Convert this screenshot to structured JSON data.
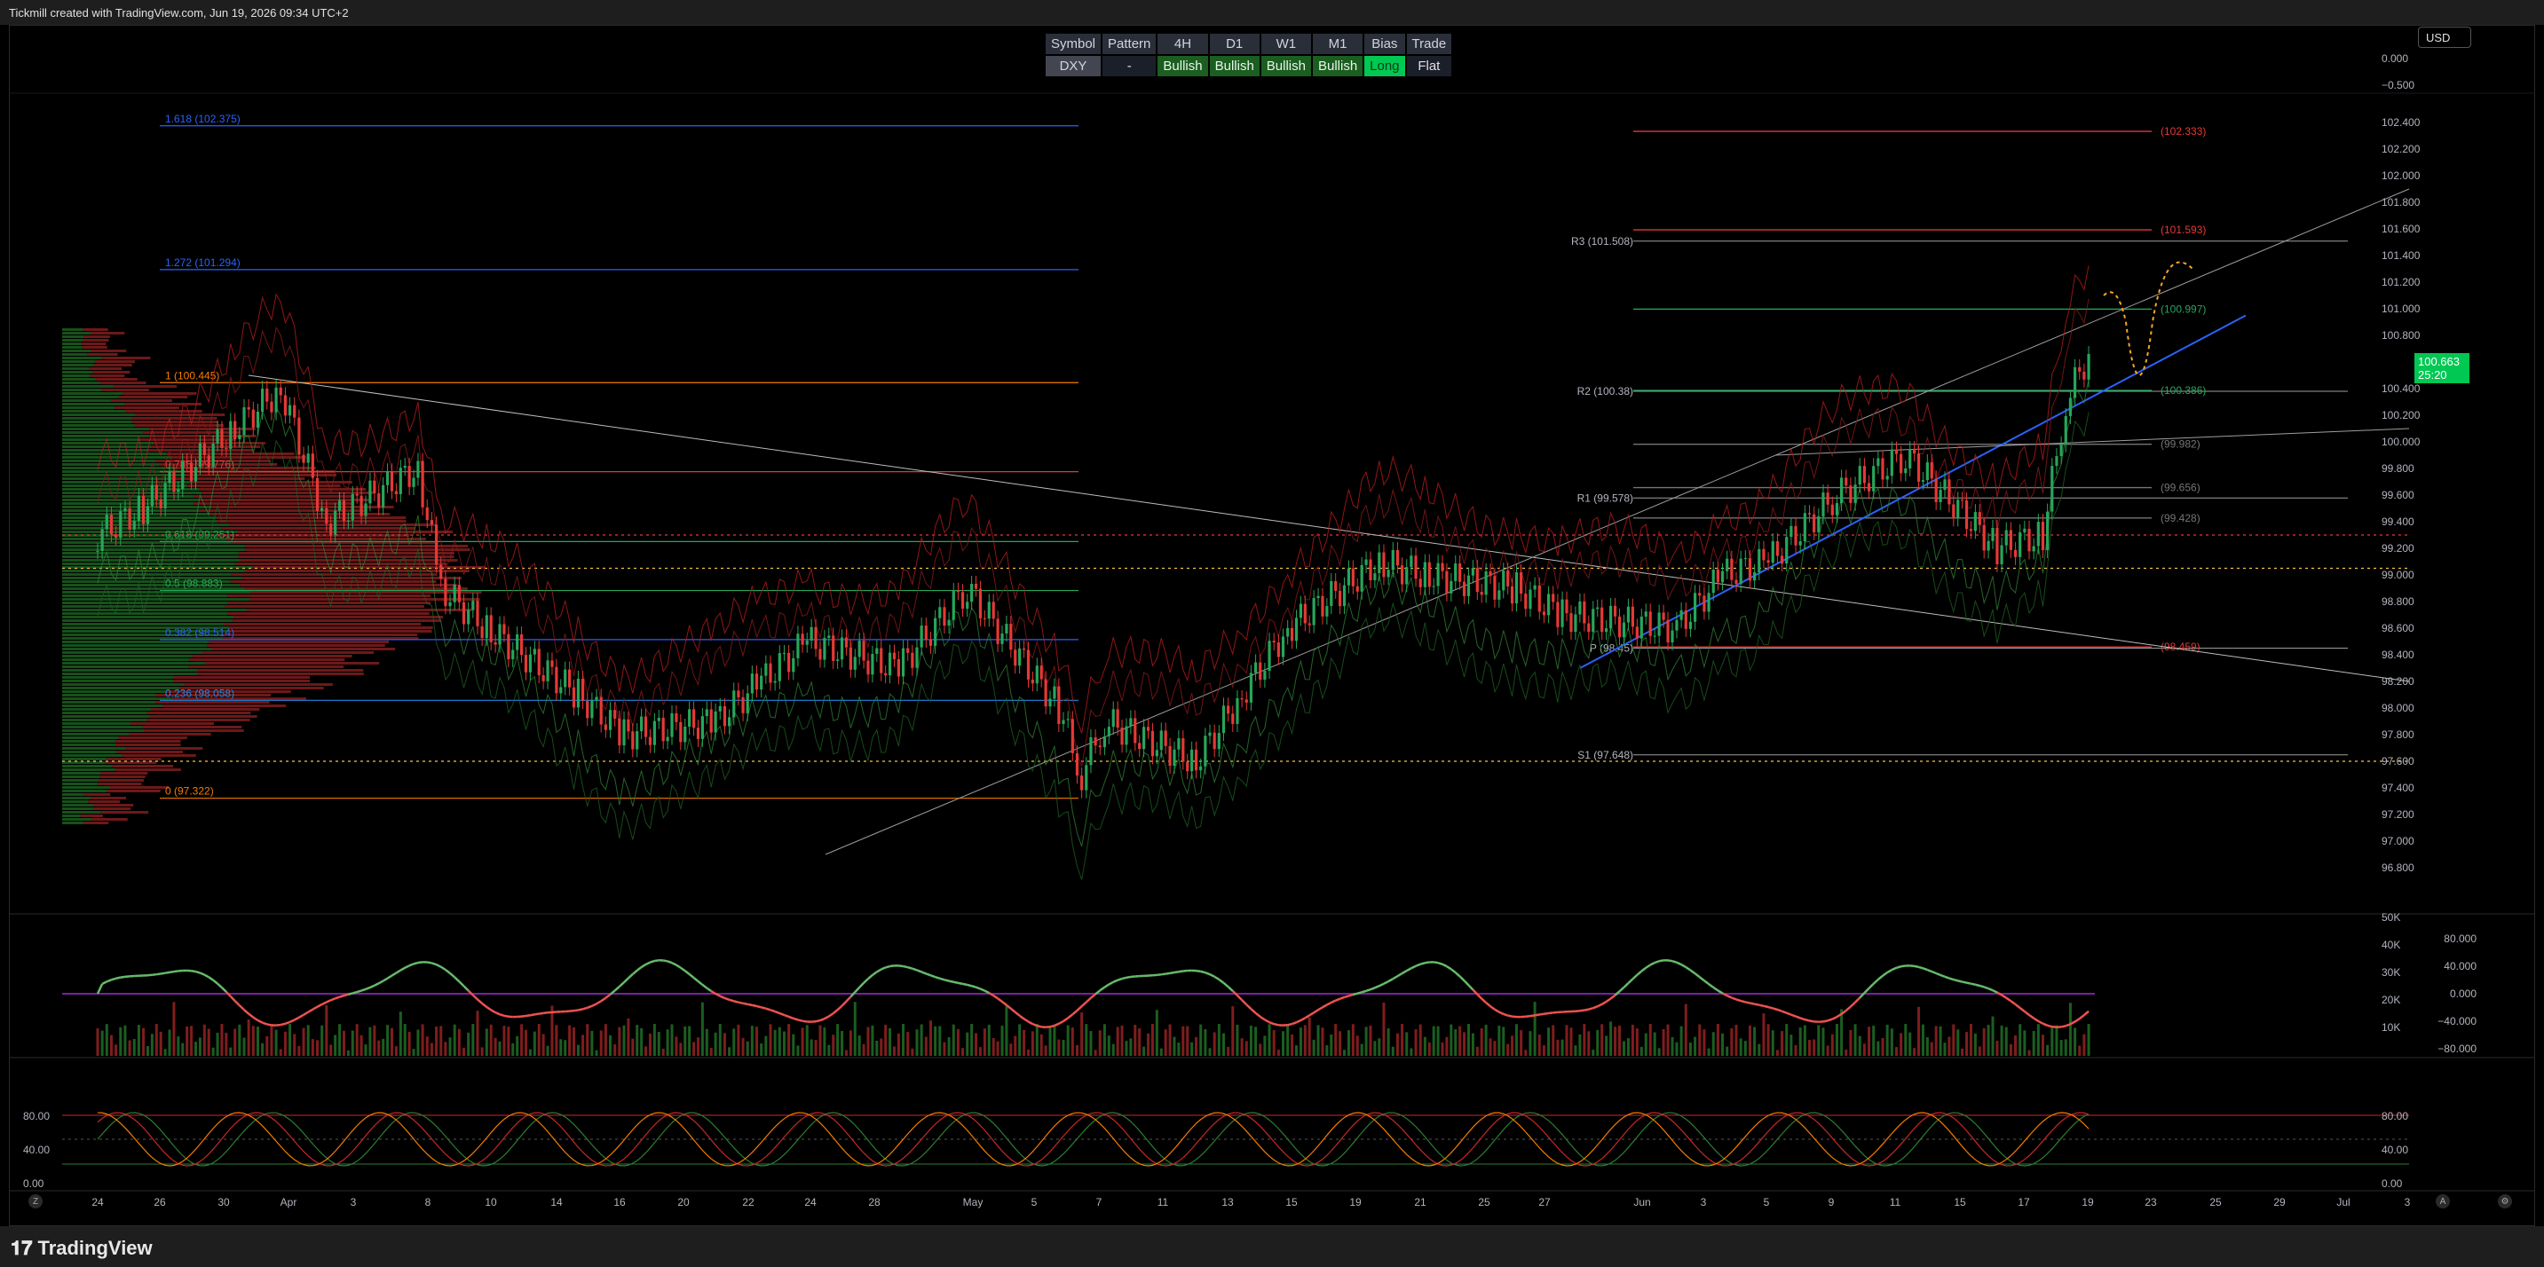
{
  "header": {
    "credit": "Tickmill created with TradingView.com, Jun 19, 2026 09:34 UTC+2"
  },
  "footer": {
    "brand": "TradingView"
  },
  "currency": "USD",
  "signal_table": {
    "headers": [
      "Symbol",
      "Pattern",
      "4H",
      "D1",
      "W1",
      "M1",
      "Bias",
      "Trade"
    ],
    "row": [
      "DXY",
      "-",
      "Bullish",
      "Bullish",
      "Bullish",
      "Bullish",
      "Long",
      "Flat"
    ]
  },
  "last_price": {
    "value": "100.663",
    "countdown": "25:20"
  },
  "price_axis": [
    "102.400",
    "102.200",
    "102.000",
    "101.800",
    "101.600",
    "101.400",
    "101.200",
    "101.000",
    "100.800",
    "100.400",
    "100.200",
    "100.000",
    "99.800",
    "99.600",
    "99.400",
    "99.200",
    "99.000",
    "98.800",
    "98.600",
    "98.400",
    "98.200",
    "98.000",
    "97.800",
    "97.600",
    "97.400",
    "97.200",
    "97.000",
    "96.800"
  ],
  "small_axis_top": [
    "0.000",
    "−0.500"
  ],
  "volume_axis": [
    "50K",
    "40K",
    "30K",
    "20K",
    "10K"
  ],
  "osc_axis": [
    "80.000",
    "40.000",
    "0.000",
    "−40.000",
    "−80.000"
  ],
  "stoch_axis": [
    "80.00",
    "40.00",
    "0.00"
  ],
  "stoch_left_axis": [
    "80.00",
    "40.00",
    "0.00"
  ],
  "time_axis": [
    "24",
    "26",
    "30",
    "Apr",
    "3",
    "8",
    "10",
    "14",
    "16",
    "20",
    "22",
    "24",
    "28",
    "May",
    "5",
    "7",
    "11",
    "13",
    "15",
    "19",
    "21",
    "25",
    "27",
    "Jun",
    "3",
    "5",
    "9",
    "11",
    "15",
    "17",
    "19",
    "23",
    "25",
    "29",
    "Jul",
    "3"
  ],
  "fib_labels": [
    "1.618 (102.375)",
    "1.272 (101.294)",
    "1 (100.445)",
    "0.786 (99.776)",
    "0.618 (99.251)",
    "0.5 (98.883)",
    "0.382 (98.514)",
    "0.236 (98.058)",
    "0 (97.322)"
  ],
  "pivot_labels": [
    "R3 (101.508)",
    "R2 (100.38)",
    "R1 (99.578)",
    "P (98.45)",
    "S1 (97.648)"
  ],
  "target_labels": [
    "(102.333)",
    "(101.593)",
    "(100.997)",
    "(100.386)",
    "(99.982)",
    "(99.656)",
    "(99.428)",
    "(98.459)"
  ],
  "colors": {
    "bull": "#26a65b",
    "bear": "#e53935",
    "fib_blue": "#2962ff",
    "fib_orange": "#f57c00",
    "long": "#00c853"
  },
  "chart_data": {
    "type": "line",
    "title": "DXY",
    "x_range": [
      "Mar 24",
      "Jul 3"
    ],
    "ylim": [
      96.8,
      102.4
    ],
    "close_path": [
      [
        "Mar 24",
        99.3
      ],
      [
        "Mar 26",
        99.5
      ],
      [
        "Mar 30",
        100.1
      ],
      [
        "Apr 1",
        100.4
      ],
      [
        "Apr 3",
        99.4
      ],
      [
        "Apr 7",
        99.8
      ],
      [
        "Apr 8",
        98.9
      ],
      [
        "Apr 10",
        98.6
      ],
      [
        "Apr 14",
        98.1
      ],
      [
        "Apr 16",
        97.8
      ],
      [
        "Apr 20",
        97.9
      ],
      [
        "Apr 22",
        98.2
      ],
      [
        "Apr 24",
        98.5
      ],
      [
        "Apr 28",
        98.3
      ],
      [
        "May 1",
        98.9
      ],
      [
        "May 5",
        98.0
      ],
      [
        "May 6",
        97.5
      ],
      [
        "May 7",
        97.9
      ],
      [
        "May 11",
        97.6
      ],
      [
        "May 13",
        98.1
      ],
      [
        "May 15",
        98.6
      ],
      [
        "May 19",
        99.1
      ],
      [
        "May 21",
        99.0
      ],
      [
        "May 25",
        98.9
      ],
      [
        "May 27",
        98.7
      ],
      [
        "Jun 1",
        98.6
      ],
      [
        "Jun 3",
        99.0
      ],
      [
        "Jun 5",
        99.1
      ],
      [
        "Jun 8",
        99.6
      ],
      [
        "Jun 11",
        99.9
      ],
      [
        "Jun 15",
        99.2
      ],
      [
        "Jun 17",
        99.3
      ],
      [
        "Jun 18",
        100.3
      ],
      [
        "Jun 19",
        100.66
      ]
    ]
  }
}
